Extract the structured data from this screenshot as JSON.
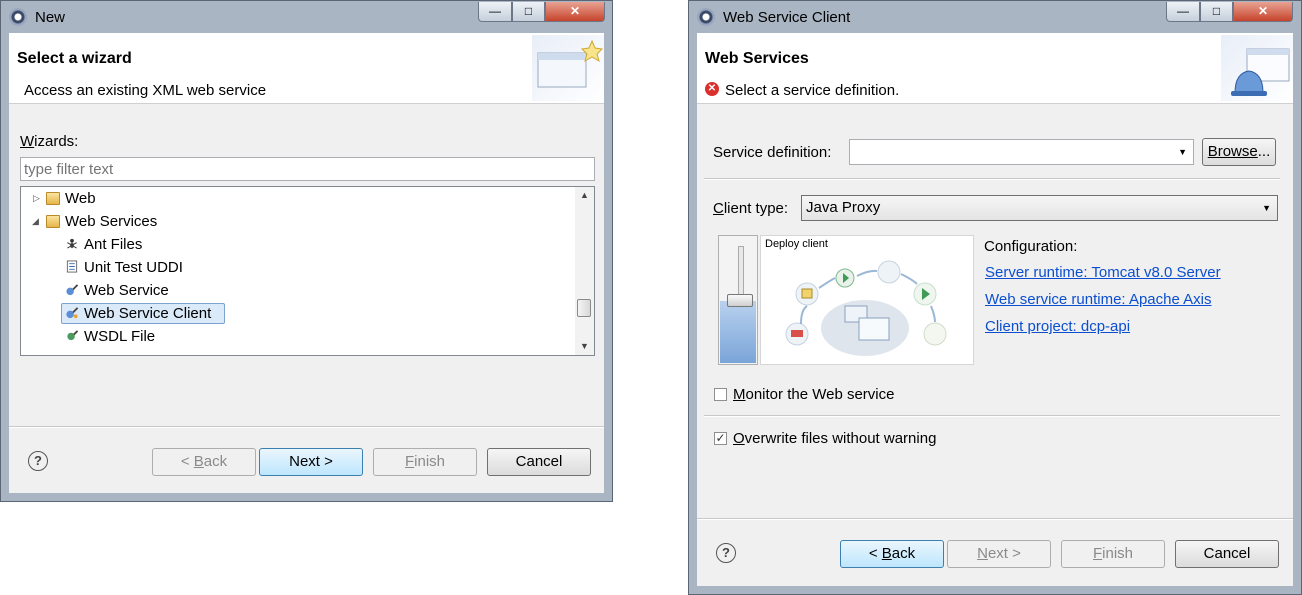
{
  "left_dialog": {
    "title": "New",
    "banner_title": "Select a wizard",
    "banner_message": "Access an existing XML web service",
    "wizards_label_underlined": "W",
    "wizards_label_rest": "izards:",
    "filter_placeholder": "type filter text",
    "tree": [
      {
        "label": "Web",
        "icon": "folder-icon",
        "expanded": false
      },
      {
        "label": "Web Services",
        "icon": "folder-open-icon",
        "expanded": true
      },
      {
        "label": "Ant Files",
        "icon": "ant-icon"
      },
      {
        "label": "Unit Test UDDI",
        "icon": "uddi-icon"
      },
      {
        "label": "Web Service",
        "icon": "web-service-icon"
      },
      {
        "label": "Web Service Client",
        "icon": "web-service-client-icon",
        "selected": true
      },
      {
        "label": "WSDL File",
        "icon": "wsdl-icon"
      }
    ],
    "buttons": {
      "back_pre": "< ",
      "back_u": "B",
      "back_rest": "ack",
      "next": "Next >",
      "finish_u": "F",
      "finish_rest": "inish",
      "cancel": "Cancel"
    }
  },
  "right_dialog": {
    "title": "Web Service Client",
    "banner_title": "Web Services",
    "banner_message": "Select a service definition.",
    "service_definition_label": "Service definition:",
    "service_definition_value": "",
    "browse_u": "Browse",
    "browse_rest": "...",
    "client_type_u": "C",
    "client_type_rest": "lient type:",
    "client_type_value": "Java Proxy",
    "slider_caption": "Deploy client",
    "configuration_label": "Configuration:",
    "links": {
      "server_runtime": "Server runtime: Tomcat v8.0 Server",
      "ws_runtime": "Web service runtime: Apache Axis",
      "client_project": "Client project: dcp-api"
    },
    "monitor_u": "M",
    "monitor_rest": "onitor the Web service",
    "monitor_checked": false,
    "overwrite_u": "O",
    "overwrite_rest": "verwrite files without warning",
    "overwrite_checked": true,
    "buttons": {
      "back_pre": "< ",
      "back_u": "B",
      "back_rest": "ack",
      "next_u": "N",
      "next_rest": "ext >",
      "finish_u": "F",
      "finish_rest": "inish",
      "cancel": "Cancel"
    }
  },
  "window_controls": {
    "minimize": "—",
    "maximize": "□",
    "close": "✕"
  },
  "help_glyph": "?",
  "colors": {
    "accent_link": "#0b4fd0",
    "error": "#d9302c",
    "window_frame": "#aab5c3",
    "selection": "#dbeaf9"
  }
}
